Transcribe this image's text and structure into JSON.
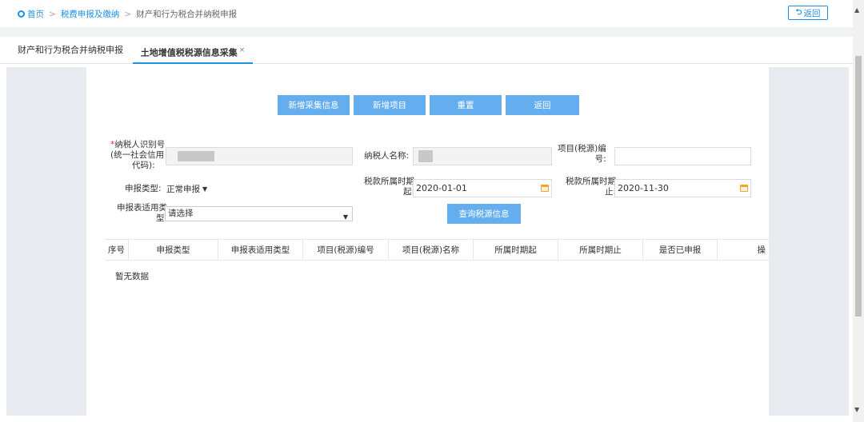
{
  "breadcrumb": {
    "home": "首页",
    "sep": ">",
    "level1": "税费申报及缴纳",
    "current": "财产和行为税合并纳税申报"
  },
  "back_top_label": "返回",
  "tabs": [
    {
      "label": "财产和行为税合并纳税申报"
    },
    {
      "label": "土地增值税税源信息采集",
      "close": "×"
    }
  ],
  "actions": {
    "add_collect": "新增采集信息",
    "add_project": "新增项目",
    "reset": "重置",
    "back": "返回"
  },
  "form": {
    "taxpayer_id_label_req": "*",
    "taxpayer_id_label_1": "纳税人识别号",
    "taxpayer_id_label_2": "(统一社会信用",
    "taxpayer_id_label_3": "代码):",
    "taxpayer_name_label": "纳税人名称:",
    "project_code_label_1": "项目(税源)编",
    "project_code_label_2": "号:",
    "project_code_value": "",
    "declare_type_label": "申报类型:",
    "declare_type_value": "正常申报",
    "period_start_label_1": "税款所属时期",
    "period_start_label_2": "起:",
    "period_start_value": "2020-01-01",
    "period_end_label_1": "税款所属时期",
    "period_end_label_2": "止:",
    "period_end_value": "2020-11-30",
    "form_type_label_1": "申报表适用类",
    "form_type_label_2": "型:",
    "form_type_value": "请选择",
    "query_button": "查询税源信息"
  },
  "table": {
    "columns": [
      "序号",
      "申报类型",
      "申报表适用类型",
      "项目(税源)编号",
      "项目(税源)名称",
      "所属时期起",
      "所属时期止",
      "是否已申报",
      "操"
    ],
    "empty_text": "暂无数据"
  },
  "colors": {
    "accent": "#1e8fe3",
    "button": "#64aef0",
    "side_panel": "#e8ebef"
  }
}
